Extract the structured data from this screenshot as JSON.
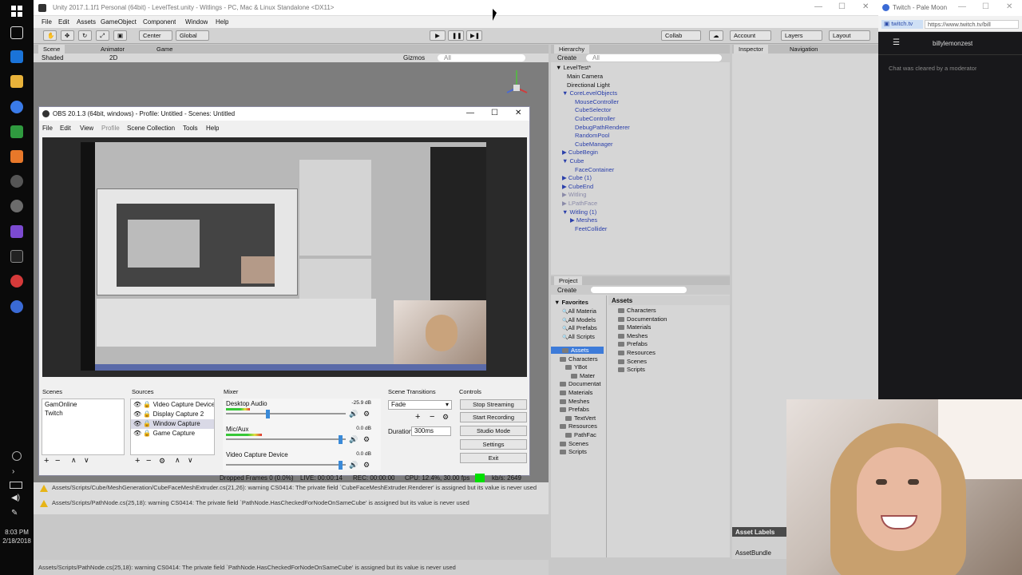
{
  "taskbar": {
    "time": "8:03 PM",
    "date": "2/18/2018",
    "icons": [
      "windows-start-icon",
      "task-view-icon",
      "edge-icon",
      "file-explorer-icon",
      "chrome-icon",
      "vim-icon",
      "sublime-icon",
      "unity-icon",
      "obs-icon",
      "visual-studio-icon",
      "terminal-icon",
      "pale-moon-icon",
      "steam-icon"
    ]
  },
  "unity": {
    "title": "Unity 2017.1.1f1 Personal (64bit) - LevelTest.unity - Witlings - PC, Mac & Linux Standalone <DX11>",
    "menu": [
      "File",
      "Edit",
      "Assets",
      "GameObject",
      "Component",
      "Window",
      "Help"
    ],
    "toolbar": {
      "center": "Center",
      "global": "Global",
      "collab": "Collab",
      "account": "Account",
      "layers": "Layers",
      "layout": "Layout"
    },
    "scene_tabs": {
      "scene": "Scene",
      "animator": "Animator",
      "game": "Game"
    },
    "scene_bar": {
      "shading": "Shaded",
      "mode": "2D",
      "gizmos": "Gizmos",
      "search": "All"
    },
    "hierarchy": {
      "tab": "Hierarchy",
      "create": "Create",
      "search": "All",
      "scene": "LevelTest*",
      "items": [
        {
          "label": "Main Camera",
          "indent": 1,
          "style": "black"
        },
        {
          "label": "Directional Light",
          "indent": 1,
          "style": "black"
        },
        {
          "label": "CoreLevelObjects",
          "indent": 1,
          "style": "blue",
          "arrow": "▼"
        },
        {
          "label": "MouseController",
          "indent": 2,
          "style": "blue"
        },
        {
          "label": "CubeSelector",
          "indent": 2,
          "style": "blue"
        },
        {
          "label": "CubeController",
          "indent": 2,
          "style": "blue"
        },
        {
          "label": "DebugPathRenderer",
          "indent": 2,
          "style": "blue"
        },
        {
          "label": "RandomPool",
          "indent": 2,
          "style": "blue"
        },
        {
          "label": "CubeManager",
          "indent": 2,
          "style": "blue"
        },
        {
          "label": "CubeBegin",
          "indent": 1,
          "style": "blue",
          "arrow": "▶"
        },
        {
          "label": "Cube",
          "indent": 1,
          "style": "blue",
          "arrow": "▼"
        },
        {
          "label": "FaceContainer",
          "indent": 2,
          "style": "blue"
        },
        {
          "label": "Cube (1)",
          "indent": 1,
          "style": "blue",
          "arrow": "▶"
        },
        {
          "label": "CubeEnd",
          "indent": 1,
          "style": "blue",
          "arrow": "▶"
        },
        {
          "label": "Witling",
          "indent": 1,
          "style": "gray",
          "arrow": "▶"
        },
        {
          "label": "LPathFace",
          "indent": 1,
          "style": "gray",
          "arrow": "▶"
        },
        {
          "label": "Witling (1)",
          "indent": 1,
          "style": "blue",
          "arrow": "▼"
        },
        {
          "label": "Meshes",
          "indent": 2,
          "style": "blue",
          "arrow": "▶"
        },
        {
          "label": "FeetCollider",
          "indent": 2,
          "style": "blue"
        }
      ]
    },
    "inspector": {
      "tab": "Inspector",
      "navigation": "Navigation"
    },
    "project": {
      "tab": "Project",
      "create": "Create",
      "favorites": "Favorites",
      "favorites_items": [
        "All Materia",
        "All Models",
        "All Prefabs",
        "All Scripts"
      ],
      "tree": [
        {
          "label": "Assets",
          "indent": 0,
          "selected": true
        },
        {
          "label": "Characters",
          "indent": 1
        },
        {
          "label": "YBot",
          "indent": 2
        },
        {
          "label": "Mater",
          "indent": 3
        },
        {
          "label": "Documentat",
          "indent": 1
        },
        {
          "label": "Materials",
          "indent": 1
        },
        {
          "label": "Meshes",
          "indent": 1
        },
        {
          "label": "Prefabs",
          "indent": 1
        },
        {
          "label": "TextVert",
          "indent": 2
        },
        {
          "label": "Resources",
          "indent": 1
        },
        {
          "label": "PathFac",
          "indent": 2
        },
        {
          "label": "Scenes",
          "indent": 1
        },
        {
          "label": "Scripts",
          "indent": 1
        }
      ],
      "breadcrumb": "Assets",
      "folders": [
        "Characters",
        "Documentation",
        "Materials",
        "Meshes",
        "Prefabs",
        "Resources",
        "Scenes",
        "Scripts"
      ],
      "asset_labels": "Asset Labels",
      "asset_bundle": "AssetBundle"
    },
    "console": {
      "lines": [
        "Assets/Scripts/Cube/MeshGeneration/CubeFaceMeshExtruder.cs(21,26): warning CS0414: The private field `CubeFaceMeshExtruder.Renderer' is assigned but its value is never used",
        "Assets/Scripts/PathNode.cs(25,18): warning CS0414: The private field `PathNode.HasCheckedForNodeOnSameCube' is assigned but its value is never used"
      ]
    },
    "status": "Assets/Scripts/PathNode.cs(25,18): warning CS0414: The private field `PathNode.HasCheckedForNodeOnSameCube' is assigned but its value is never used"
  },
  "obs": {
    "title": "OBS 20.1.3 (64bit, windows) - Profile: Untitled - Scenes: Untitled",
    "menu": [
      "File",
      "Edit",
      "View",
      "Profile",
      "Scene Collection",
      "Tools",
      "Help"
    ],
    "scenes_header": "Scenes",
    "scenes": [
      "GamOnline",
      "Twitch"
    ],
    "sources_header": "Sources",
    "sources": [
      "Video Capture Device",
      "Display Capture 2",
      "Window Capture",
      "Game Capture"
    ],
    "mixer_header": "Mixer",
    "mixer": [
      {
        "name": "Desktop Audio",
        "db": "-25.9 dB",
        "level": 0.2
      },
      {
        "name": "Mic/Aux",
        "db": "0.0 dB",
        "level": 0.3
      },
      {
        "name": "Video Capture Device",
        "db": "0.0 dB",
        "level": 0.0
      }
    ],
    "transitions_header": "Scene Transitions",
    "transition": "Fade",
    "duration_label": "Duration",
    "duration": "300ms",
    "controls_header": "Controls",
    "controls": [
      "Stop Streaming",
      "Start Recording",
      "Studio Mode",
      "Settings",
      "Exit"
    ],
    "status": {
      "dropped": "Dropped Frames 0 (0.0%)",
      "live": "LIVE: 00:00:14",
      "rec": "REC: 00:00:00",
      "cpu": "CPU: 12.4%, 30.00 fps",
      "kbps": "kb/s: 2649"
    }
  },
  "palemoon": {
    "title": "Twitch - Pale Moon",
    "tab": "twitch.tv",
    "url": "https://www.twitch.tv/bill",
    "channel": "billylemonzest",
    "chat": "Chat was cleared by a moderator"
  }
}
